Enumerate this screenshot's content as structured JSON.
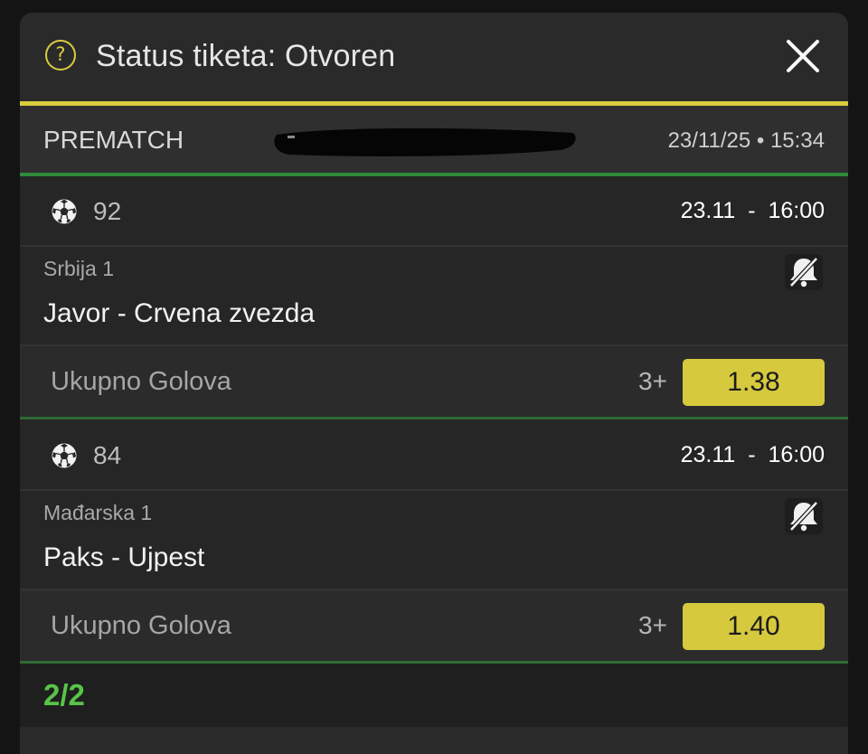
{
  "header": {
    "title": "Status tiketa: Otvoren",
    "help_icon": "?",
    "close_icon": "close-icon",
    "accent_color": "#d9cc3f"
  },
  "ticket": {
    "type": "PREMATCH",
    "datetime": "23/11/25 • 15:34"
  },
  "events": [
    {
      "sport_icon": "soccer-ball-icon",
      "code": "92",
      "time": "23.11  -  16:00",
      "league": "Srbija 1",
      "notification_icon": "bell-off-icon",
      "match": "Javor - Crvena zvezda",
      "market": "Ukupno Golova",
      "pick": "3+",
      "odd": "1.38"
    },
    {
      "sport_icon": "soccer-ball-icon",
      "code": "84",
      "time": "23.11  -  16:00",
      "league": "Mađarska 1",
      "notification_icon": "bell-off-icon",
      "match": "Paks - Ujpest",
      "market": "Ukupno Golova",
      "pick": "3+",
      "odd": "1.40"
    }
  ],
  "summary": {
    "count": "2/2",
    "count_color": "#57c548"
  }
}
